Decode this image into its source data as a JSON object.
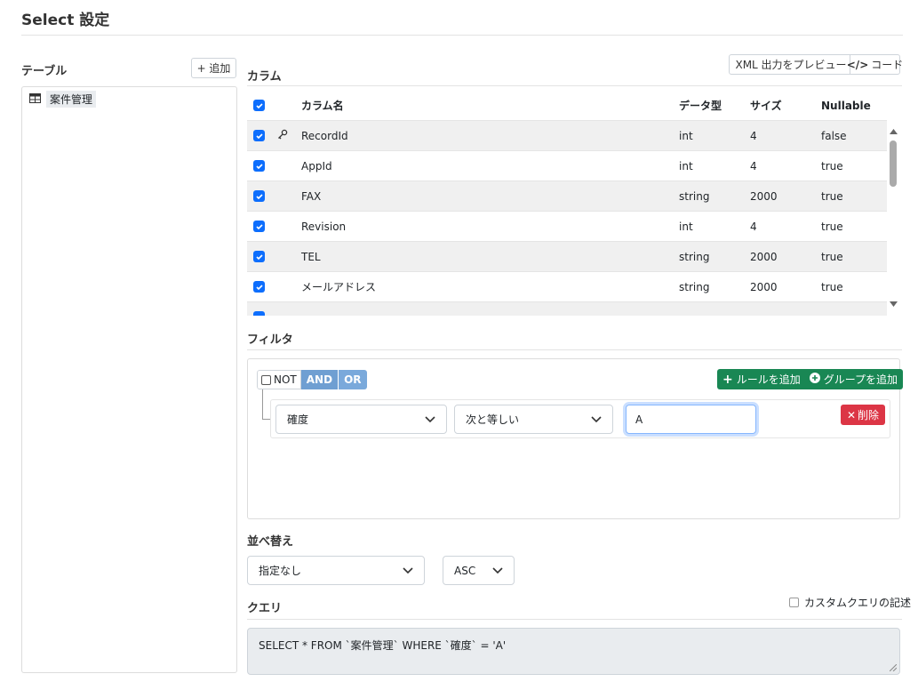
{
  "page": {
    "title": "Select 設定"
  },
  "tables": {
    "heading": "テーブル",
    "add_button": "+ 追加",
    "items": [
      {
        "label": "案件管理",
        "icon": "table-icon"
      }
    ]
  },
  "columns": {
    "heading": "カラム",
    "preview_button": "XML 出力をプレビュー",
    "code_button": "コード",
    "headers": {
      "name": "カラム名",
      "type": "データ型",
      "size": "サイズ",
      "nullable": "Nullable"
    },
    "rows": [
      {
        "checked": true,
        "key": true,
        "name": "RecordId",
        "type": "int",
        "size": "4",
        "nullable": "false"
      },
      {
        "checked": true,
        "key": false,
        "name": "AppId",
        "type": "int",
        "size": "4",
        "nullable": "true"
      },
      {
        "checked": true,
        "key": false,
        "name": "FAX",
        "type": "string",
        "size": "2000",
        "nullable": "true"
      },
      {
        "checked": true,
        "key": false,
        "name": "Revision",
        "type": "int",
        "size": "4",
        "nullable": "true"
      },
      {
        "checked": true,
        "key": false,
        "name": "TEL",
        "type": "string",
        "size": "2000",
        "nullable": "true"
      },
      {
        "checked": true,
        "key": false,
        "name": "メールアドレス",
        "type": "string",
        "size": "2000",
        "nullable": "true"
      }
    ]
  },
  "filter": {
    "heading": "フィルタ",
    "not_label": "NOT",
    "and_label": "AND",
    "or_label": "OR",
    "add_rule": "ルールを追加",
    "add_group": "グループを追加",
    "rule": {
      "field": "確度",
      "operator": "次と等しい",
      "value": "A",
      "delete_label": "削除"
    }
  },
  "sort": {
    "heading": "並べ替え",
    "field": "指定なし",
    "direction": "ASC"
  },
  "query": {
    "heading": "クエリ",
    "custom_label": "カスタムクエリの記述",
    "sql": "SELECT * FROM `案件管理` WHERE `確度` = 'A'"
  },
  "colors": {
    "primary": "#0d6efd",
    "success": "#198754",
    "danger": "#dc3545",
    "toggle": "#6f9fd2"
  }
}
